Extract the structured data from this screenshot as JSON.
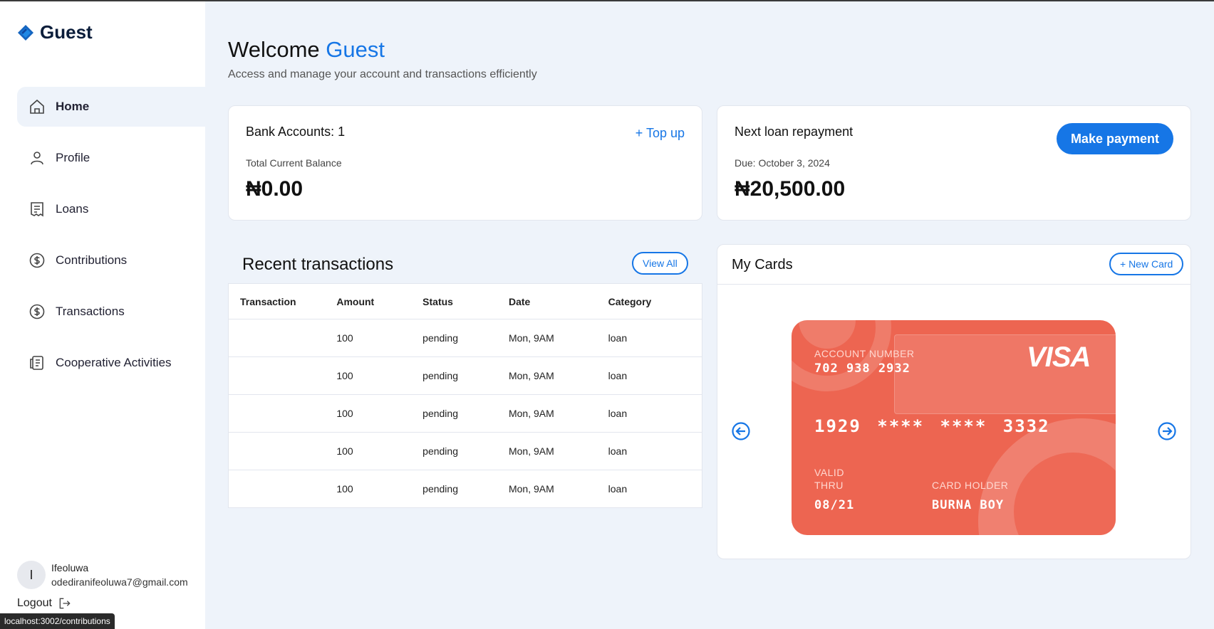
{
  "brand": {
    "name": "Guest"
  },
  "nav": [
    {
      "label": "Home",
      "icon": "home-icon",
      "active": true
    },
    {
      "label": "Profile",
      "icon": "user-icon"
    },
    {
      "label": "Loans",
      "icon": "receipt-icon"
    },
    {
      "label": "Contributions",
      "icon": "dollar-circle-icon"
    },
    {
      "label": "Transactions",
      "icon": "dollar-circle-icon"
    },
    {
      "label": "Cooperative Activities",
      "icon": "document-icon"
    }
  ],
  "user": {
    "initial": "I",
    "name": "Ifeoluwa",
    "email": "odediranifeoluwa7@gmail.com"
  },
  "logout_label": "Logout",
  "status_url": "localhost:3002/contributions",
  "header": {
    "welcome": "Welcome",
    "name": "Guest",
    "subtitle": "Access and manage your account and transactions efficiently"
  },
  "accounts_card": {
    "title": "Bank Accounts: 1",
    "topup": "+ Top up",
    "label": "Total Current Balance",
    "amount": "₦0.00"
  },
  "loan_card": {
    "title": "Next loan repayment",
    "button": "Make payment",
    "due": "Due: October 3, 2024",
    "amount": "₦20,500.00"
  },
  "transactions": {
    "title": "Recent transactions",
    "view_all": "View All",
    "columns": [
      "Transaction",
      "Amount",
      "Status",
      "Date",
      "Category"
    ],
    "rows": [
      [
        "",
        "100",
        "pending",
        "Mon, 9AM",
        "loan"
      ],
      [
        "",
        "100",
        "pending",
        "Mon, 9AM",
        "loan"
      ],
      [
        "",
        "100",
        "pending",
        "Mon, 9AM",
        "loan"
      ],
      [
        "",
        "100",
        "pending",
        "Mon, 9AM",
        "loan"
      ],
      [
        "",
        "100",
        "pending",
        "Mon, 9AM",
        "loan"
      ]
    ]
  },
  "cards": {
    "title": "My Cards",
    "new_card": "+ New Card",
    "card": {
      "account_label": "ACCOUNT NUMBER",
      "account_number": "702 938 2932",
      "brand": "VISA",
      "number": "1929 **** **** 3332",
      "valid_label_1": "VALID",
      "valid_label_2": "THRU",
      "valid": "08/21",
      "holder_label": "CARD HOLDER",
      "holder": "BURNA BOY",
      "color": "#ed6551"
    }
  },
  "colors": {
    "accent": "#1676e6",
    "background": "#eef3fa"
  }
}
